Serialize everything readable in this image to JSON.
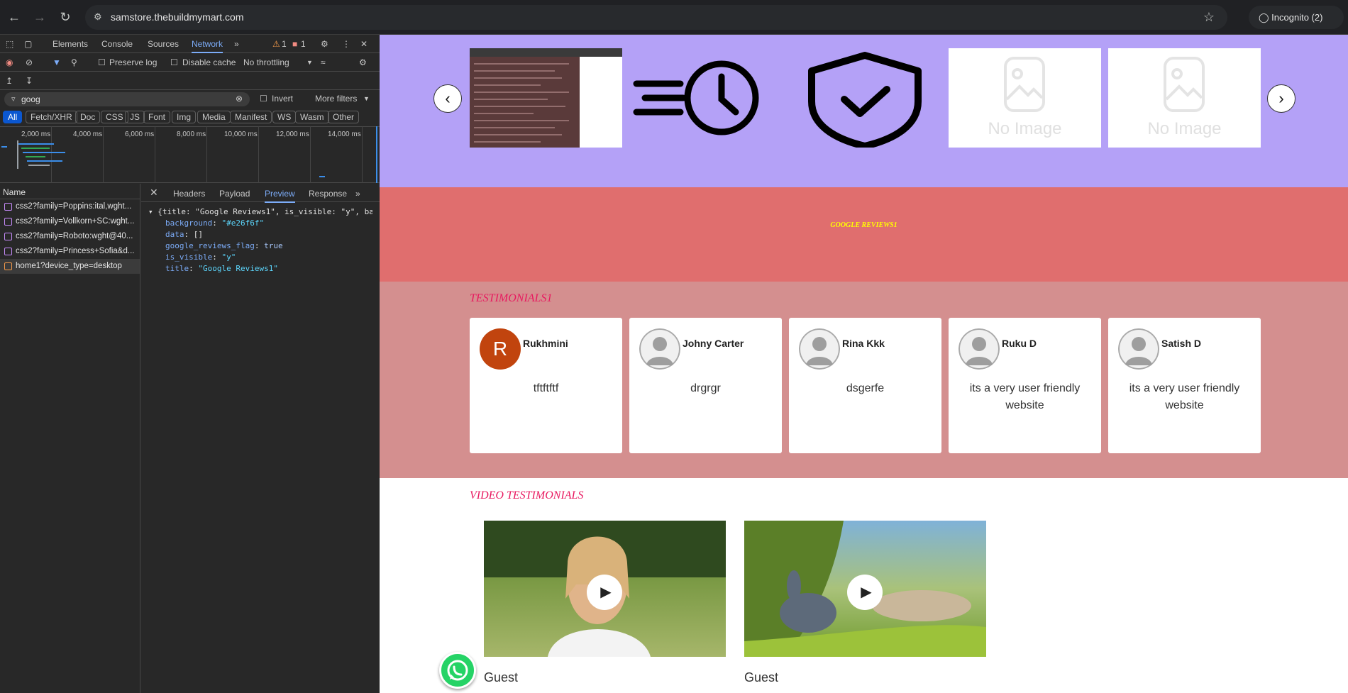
{
  "browser": {
    "url": "samstore.thebuildmymart.com",
    "incognito_label": "Incognito (2)"
  },
  "devtools": {
    "tabs": [
      "Elements",
      "Console",
      "Sources",
      "Network"
    ],
    "active_tab": "Network",
    "warn_count": "1",
    "error_count": "1",
    "preserve_log": "Preserve log",
    "disable_cache": "Disable cache",
    "throttling": "No throttling",
    "filter_value": "goog",
    "invert": "Invert",
    "more_filters": "More filters",
    "type_filters": [
      "All",
      "Fetch/XHR",
      "Doc",
      "CSS",
      "JS",
      "Font",
      "Img",
      "Media",
      "Manifest",
      "WS",
      "Wasm",
      "Other"
    ],
    "timeline_ticks": [
      "2,000 ms",
      "4,000 ms",
      "6,000 ms",
      "8,000 ms",
      "10,000 ms",
      "12,000 ms",
      "14,000 ms"
    ],
    "name_header": "Name",
    "requests": [
      "css2?family=Poppins:ital,wght...",
      "css2?family=Vollkorn+SC:wght...",
      "css2?family=Roboto:wght@40...",
      "css2?family=Princess+Sofia&d...",
      "home1?device_type=desktop"
    ],
    "detail_tabs": [
      "Headers",
      "Payload",
      "Preview",
      "Response"
    ],
    "active_detail_tab": "Preview",
    "preview": {
      "summary": "{title: \"Google Reviews1\", is_visible: \"y\", bac",
      "lines": [
        {
          "key": "background",
          "value": "\"#e26f6f\""
        },
        {
          "key": "data",
          "value": "[]"
        },
        {
          "key": "google_reviews_flag",
          "value": "true"
        },
        {
          "key": "is_visible",
          "value": "\"y\""
        },
        {
          "key": "title",
          "value": "\"Google Reviews1\""
        }
      ]
    }
  },
  "page": {
    "banner_colors": {
      "slider_bg": "#b4a1f7",
      "reviews_bg": "#e06e6e",
      "testimonials_bg": "#d48f8f"
    },
    "slides": [
      {
        "type": "screenshot"
      },
      {
        "type": "fast-clock-icon"
      },
      {
        "type": "shield-check-icon"
      },
      {
        "type": "no-image",
        "label": "No Image"
      },
      {
        "type": "no-image",
        "label": "No Image"
      }
    ],
    "google_reviews_title": "GOOGLE REVIEWS1",
    "testimonials_title": "TESTIMONIALS1",
    "testimonials": [
      {
        "name": "Rukhmini",
        "initial": "R",
        "message": "tftftftf"
      },
      {
        "name": "Johny Carter",
        "message": "drgrgr"
      },
      {
        "name": "Rina Kkk",
        "message": "dsgerfe"
      },
      {
        "name": "Ruku D",
        "message": "its a very user friendly website"
      },
      {
        "name": "Satish D",
        "message": "its a very user friendly website"
      }
    ],
    "video_title": "VIDEO TESTIMONIALS",
    "videos": [
      {
        "name": "Guest"
      },
      {
        "name": "Guest"
      }
    ]
  }
}
